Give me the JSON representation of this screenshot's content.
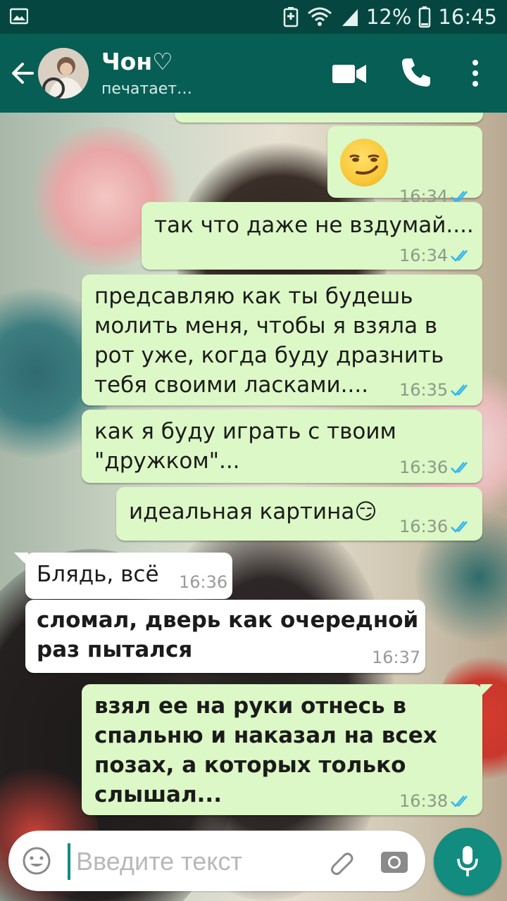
{
  "status_bar": {
    "battery_percent": "12%",
    "time": "16:45",
    "icons": [
      "gallery-icon",
      "battery-saver-icon",
      "wifi-icon",
      "signal-icon",
      "battery-icon"
    ]
  },
  "header": {
    "contact_name": "Чон♡",
    "contact_status": "печатает…",
    "icons": [
      "back-arrow-icon",
      "video-call-icon",
      "phone-call-icon",
      "more-vert-icon"
    ]
  },
  "messages": [
    {
      "dir": "out",
      "text": "😏",
      "time": "16:34",
      "status": "read"
    },
    {
      "dir": "out",
      "text": "так что даже не вздумай....",
      "time": "16:34",
      "status": "read"
    },
    {
      "dir": "out",
      "text": "предсавляю как ты будешь\nмолить меня, чтобы я взяла в\nрот уже, когда буду дразнить\nтебя своими ласками....",
      "time": "16:35",
      "status": "read"
    },
    {
      "dir": "out",
      "text": "как я буду играть с твоим\n\"дружком\"...",
      "time": "16:36",
      "status": "read"
    },
    {
      "dir": "out",
      "text": "идеальная картина😏",
      "time": "16:36",
      "status": "read"
    },
    {
      "dir": "in",
      "text": "Блядь, всё",
      "time": "16:36"
    },
    {
      "dir": "in",
      "text": "сломал, дверь как очередной\nраз пытался",
      "time": "16:37"
    },
    {
      "dir": "out",
      "text": "взял ее на руки отнесь в\nспальню и наказал на всех\nпозах, а которых только\nслышал...",
      "time": "16:38",
      "status": "read"
    }
  ],
  "input": {
    "placeholder": "Введите текст",
    "value": ""
  },
  "colors": {
    "header": "#075e54",
    "status_bar": "#054740",
    "outgoing_bubble": "#dcf8c6",
    "incoming_bubble": "#ffffff",
    "read_ticks": "#34b7f1",
    "mic_button": "#128c7e"
  }
}
